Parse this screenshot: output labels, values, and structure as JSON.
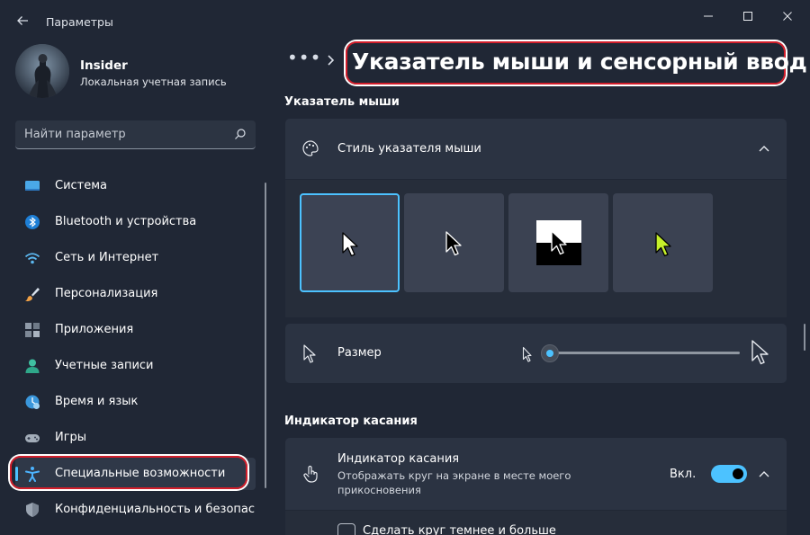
{
  "window": {
    "title": "Параметры",
    "controls": [
      "minimize-icon",
      "maximize-icon",
      "close-icon"
    ]
  },
  "user": {
    "name": "Insider",
    "account_type": "Локальная учетная запись"
  },
  "search": {
    "placeholder": "Найти параметр",
    "icon": "search-icon"
  },
  "sidebar": {
    "items": [
      {
        "label": "Система",
        "icon": "monitor-icon",
        "active": false
      },
      {
        "label": "Bluetooth и устройства",
        "icon": "bluetooth-icon",
        "active": false
      },
      {
        "label": "Сеть и Интернет",
        "icon": "wifi-icon",
        "active": false
      },
      {
        "label": "Персонализация",
        "icon": "brush-icon",
        "active": false
      },
      {
        "label": "Приложения",
        "icon": "apps-icon",
        "active": false
      },
      {
        "label": "Учетные записи",
        "icon": "person-icon",
        "active": false
      },
      {
        "label": "Время и язык",
        "icon": "clock-globe-icon",
        "active": false
      },
      {
        "label": "Игры",
        "icon": "gamepad-icon",
        "active": false
      },
      {
        "label": "Специальные возможности",
        "icon": "accessibility-icon",
        "active": true
      },
      {
        "label": "Конфиденциальность и безопас",
        "icon": "shield-icon",
        "active": false
      }
    ]
  },
  "breadcrumb": {
    "overflow": "•••",
    "title": "Указатель мыши и сенсорный ввод"
  },
  "mouse_pointer": {
    "section_title": "Указатель мыши",
    "style": {
      "label": "Стиль указателя мыши",
      "icon": "palette-icon",
      "options": [
        {
          "name": "white",
          "selected": true
        },
        {
          "name": "black",
          "selected": false
        },
        {
          "name": "inverted",
          "selected": false
        },
        {
          "name": "custom",
          "selected": false,
          "color": "#c6f02a"
        }
      ]
    },
    "size": {
      "label": "Размер",
      "icon": "pointer-icon",
      "value": 1
    }
  },
  "touch_indicator": {
    "section_title": "Индикатор касания",
    "title": "Индикатор касания",
    "description": "Отображать круг на экране в месте моего прикосновения",
    "icon": "touch-icon",
    "toggle_label": "Вкл.",
    "toggle_on": true,
    "checkbox_label": "Сделать круг темнее и больше",
    "checkbox_checked": false
  },
  "colors": {
    "accent": "#4cc2ff",
    "highlight": "#d21e2b",
    "background": "#202735"
  }
}
